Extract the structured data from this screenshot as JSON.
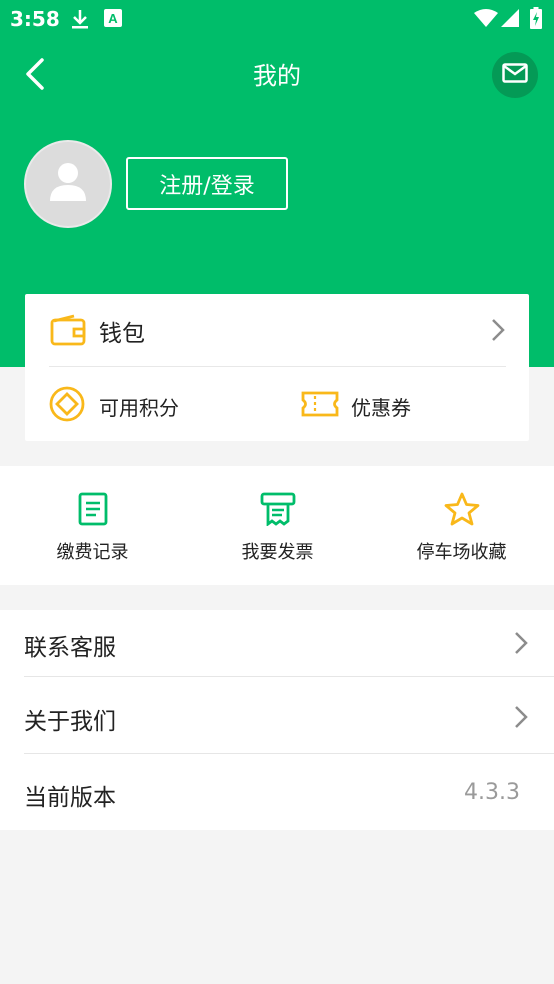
{
  "status_bar": {
    "time": "3:58",
    "icons": [
      "download-icon",
      "a-notification-icon",
      "wifi-icon",
      "signal-icon",
      "battery-charging-icon"
    ]
  },
  "header": {
    "title": "我的",
    "back_icon": "back-arrow-icon",
    "message_icon": "envelope-icon"
  },
  "profile": {
    "login_label": "注册/登录",
    "avatar_icon": "user-placeholder-icon"
  },
  "wallet_card": {
    "wallet_label": "钱包",
    "points_label": "可用积分",
    "coupon_label": "优惠券"
  },
  "quick_actions": [
    {
      "label": "缴费记录",
      "icon": "receipt-list-icon"
    },
    {
      "label": "我要发票",
      "icon": "invoice-printer-icon"
    },
    {
      "label": "停车场收藏",
      "icon": "star-outline-icon"
    }
  ],
  "menu": [
    {
      "label": "联系客服"
    },
    {
      "label": "关于我们"
    },
    {
      "label": "当前版本",
      "value": "4.3.3"
    }
  ],
  "colors": {
    "primary_green": "#00bd6a",
    "dark_green": "#049a56",
    "accent_yellow": "#f9b81a",
    "background": "#f4f4f4"
  }
}
